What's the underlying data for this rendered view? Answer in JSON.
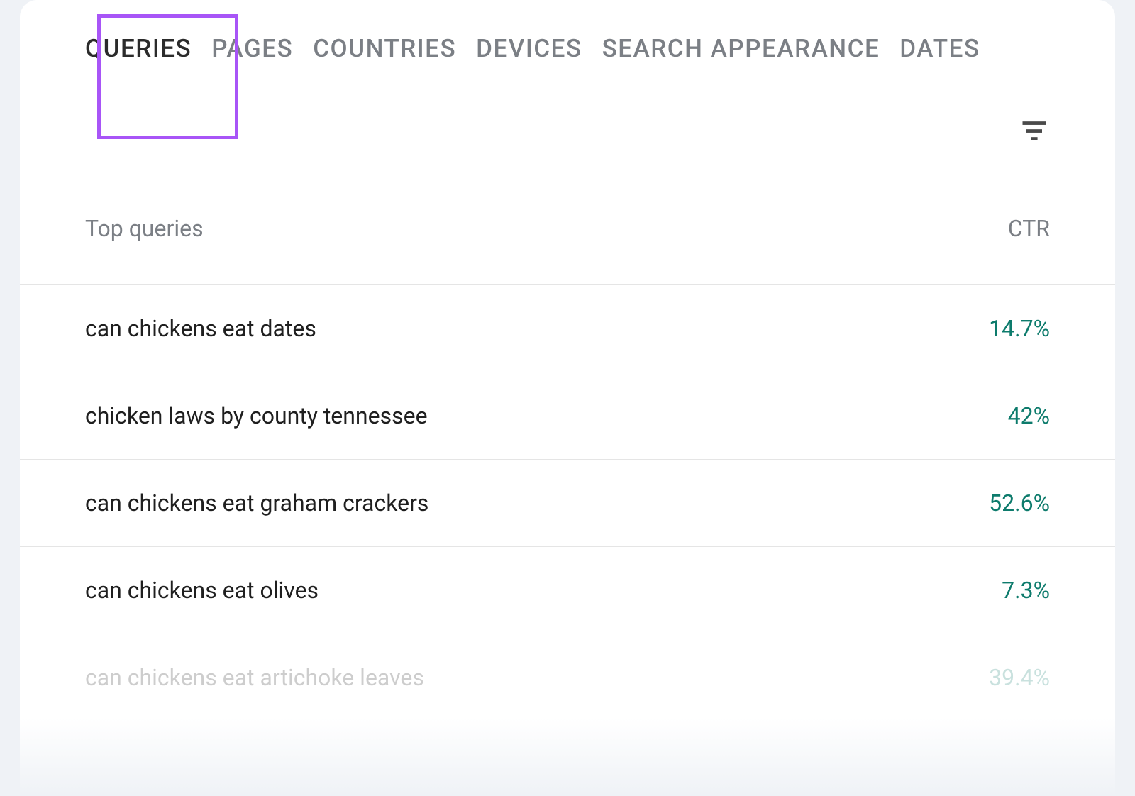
{
  "tabs": {
    "queries": "QUERIES",
    "pages": "PAGES",
    "countries": "COUNTRIES",
    "devices": "DEVICES",
    "searchAppearance": "SEARCH APPEARANCE",
    "dates": "DATES"
  },
  "headers": {
    "topQueries": "Top queries",
    "ctr": "CTR"
  },
  "rows": [
    {
      "query": "can chickens eat dates",
      "ctr": "14.7%"
    },
    {
      "query": "chicken laws by county tennessee",
      "ctr": "42%"
    },
    {
      "query": "can chickens eat graham crackers",
      "ctr": "52.6%"
    },
    {
      "query": "can chickens eat olives",
      "ctr": "7.3%"
    },
    {
      "query": "can chickens eat artichoke leaves",
      "ctr": "39.4%"
    }
  ],
  "colors": {
    "accent": "#0d7b6c",
    "highlight": "#a855f7",
    "muted": "#7b7f85"
  }
}
